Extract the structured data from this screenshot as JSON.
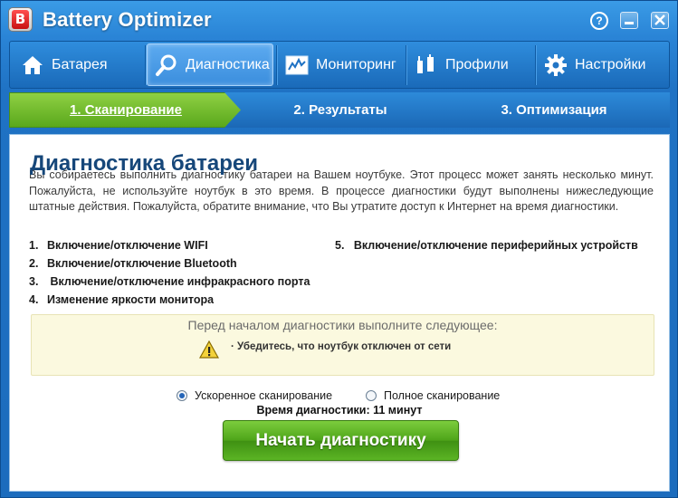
{
  "window": {
    "title": "Battery Optimizer",
    "logo_letter": "B",
    "help_label": "?",
    "minimize_label": "–",
    "maximize_label": "□",
    "close_label": "✕"
  },
  "nav": {
    "items": [
      {
        "label": "Батарея",
        "icon": "home-icon"
      },
      {
        "label": "Диагностика",
        "icon": "magnifier-icon",
        "active": true
      },
      {
        "label": "Мониторинг",
        "icon": "chart-icon"
      },
      {
        "label": "Профили",
        "icon": "plug-icon"
      },
      {
        "label": "Настройки",
        "icon": "gear-icon"
      }
    ]
  },
  "steps": [
    {
      "label": "1. Сканирование",
      "active": true
    },
    {
      "label": "2. Результаты"
    },
    {
      "label": "3. Оптимизация"
    }
  ],
  "main": {
    "heading": "Диагностика батареи",
    "description": "Вы собираетесь выполнить диагностику батареи на Вашем ноутбуке. Этот процесс может занять несколько минут. Пожалуйста, не используйте ноутбук в это время. В процессе диагностики будут выполнены нижеследующие штатные действия. Пожалуйста, обратите внимание, что Вы утратите доступ к Интернет на время диагностики.",
    "actions_left": [
      {
        "num": "1.",
        "text": "Включение/отключение WIFI"
      },
      {
        "num": "2.",
        "text": "Включение/отключение Bluetooth"
      },
      {
        "num": "3.",
        "text": " Включение/отключение инфракрасного порта"
      },
      {
        "num": "4.",
        "text": "Изменение яркости монитора"
      }
    ],
    "actions_right": [
      {
        "num": "5.",
        "text": "Включение/отключение периферийных устройств"
      }
    ],
    "notice": {
      "title": "Перед началом диагностики выполните следующее:",
      "item": "· Убедитесь, что ноутбук отключен от сети"
    },
    "scan_options": [
      {
        "label": "Ускоренное сканирование",
        "selected": true
      },
      {
        "label": "Полное сканирование",
        "selected": false
      }
    ],
    "time_text": "Время диагностики: 11 минут",
    "start_button": "Начать диагностику"
  },
  "colors": {
    "accent_blue": "#1f72c4",
    "active_step_green": "#5aa81c",
    "heading_blue": "#16477a",
    "notice_bg": "#fbf9df"
  }
}
